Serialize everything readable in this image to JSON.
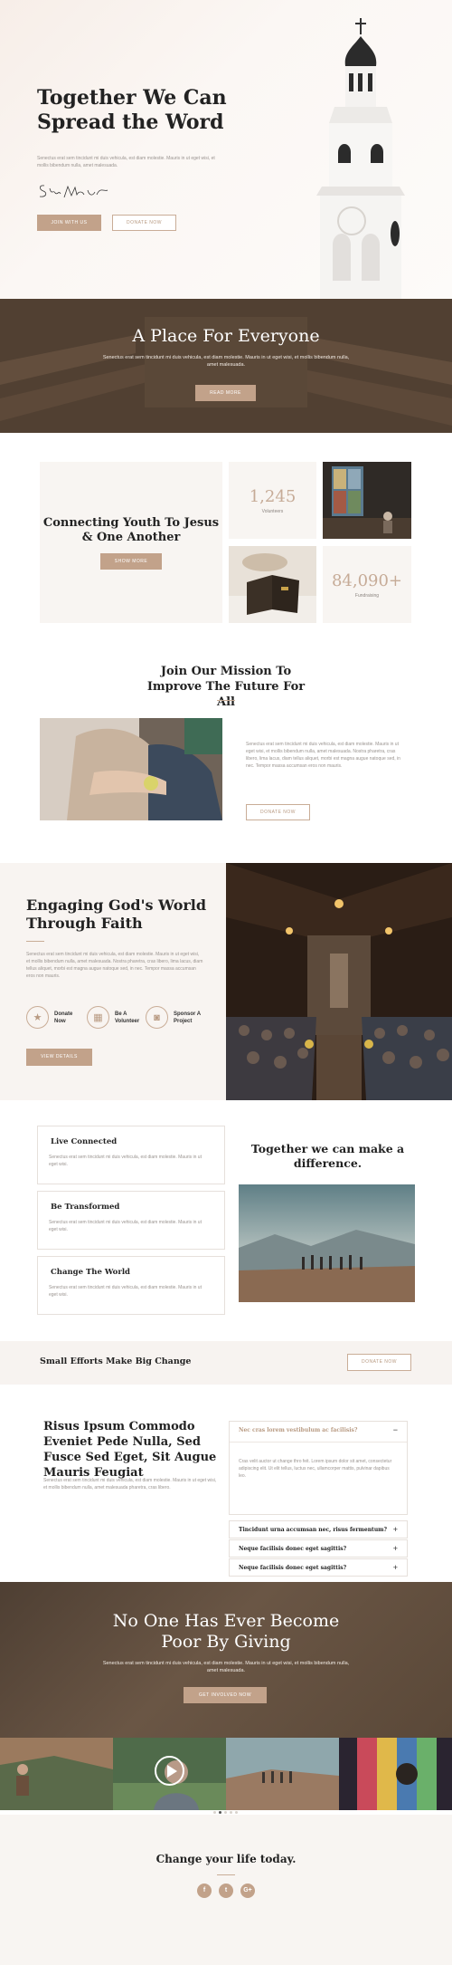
{
  "hero": {
    "title": "Together We Can Spread the Word",
    "text": "Senectus erat sem tincidunt mi duis vehicula, est diam molestie. Mauris in ut eget wisi, et mollis bibendum nulla, amet malesuada.",
    "signature": "Steve Madison",
    "join_label": "JOIN WITH US",
    "donate_label": "DONATE NOW"
  },
  "place": {
    "title": "A Place For Everyone",
    "text": "Senectus erat sem tincidunt mi duis vehicula, est diam molestie. Mauris in ut eget wisi, et mollis bibendum nulla, amet malesuada.",
    "button": "READ MORE"
  },
  "connect": {
    "title": "Connecting Youth To Jesus & One Another",
    "button": "SHOW MORE",
    "stats": [
      {
        "value": "1,245",
        "label": "Volunteers"
      },
      {
        "value": "84,090+",
        "label": "Fundraising"
      }
    ]
  },
  "mission": {
    "title": "Join Our Mission To Improve The Future For All",
    "text": "Senectus erat sem tincidunt mi duis vehicula, est diam molestie. Mauris in ut eget wisi, et mollis bibendum nulla, amet malesuada. Nostra pharetra, cras libero, lima lacus, diam tellus aliquet, morbi est magna augue natoque sed, in nec. Tempor massa accumsan eros non mauris.",
    "button": "DONATE NOW"
  },
  "engage": {
    "title": "Engaging God's World Through Faith",
    "text": "Senectus erat sem tincidunt mi duis vehicula, est diam molestie. Mauris in ut eget wisi, et mollis bibendum nulla, amet malesuada. Nostra pharetra, cras libero, lima lacus, diam tellus aliquet, morbi est magna augue natoque sed, in nec. Tempor massa accumsan eros non mauris.",
    "features": [
      {
        "icon": "star-icon",
        "label": "Donate Now"
      },
      {
        "icon": "calendar-icon",
        "label": "Be A Volunteer"
      },
      {
        "icon": "camera-icon",
        "label": "Sponsor A Project"
      }
    ],
    "button": "VIEW DETAILS"
  },
  "cards": {
    "items": [
      {
        "title": "Live Connected",
        "text": "Senectus erat sem tincidunt mi duis vehicula, est diam molestie. Mauris in ut eget wisi."
      },
      {
        "title": "Be Transformed",
        "text": "Senectus erat sem tincidunt mi duis vehicula, est diam molestie. Mauris in ut eget wisi."
      },
      {
        "title": "Change The World",
        "text": "Senectus erat sem tincidunt mi duis vehicula, est diam molestie. Mauris in ut eget wisi."
      }
    ],
    "title": "Together we can make a difference."
  },
  "efforts": {
    "title": "Small Efforts Make Big Change",
    "button": "DONATE NOW"
  },
  "faq": {
    "title": "Risus Ipsum Commodo Eveniet Pede Nulla, Sed Fusce Sed Eget, Sit Augue Mauris Feugiat",
    "text": "Senectus erat sem tincidunt mi duis vehicula, est diam molestie. Mauris in ut eget wisi, et mollis bibendum nulla, amet malesuada pharetra, cras libero.",
    "items": [
      {
        "q": "Nec cras lorem vestibulum ac facilisis?",
        "a": "Cras velit auctor ut change thro feit. Lorem ipsum dolor sit amet, consectetur adipiscing elit. Ut elit tellus, luctus nec, ullamcorper mattis, pulvinar dapibus leo.",
        "open": true
      },
      {
        "q": "Tincidunt urna accumsan nec, risus fermentum?",
        "open": false
      },
      {
        "q": "Neque facilisis donec eget sagittis?",
        "open": false
      },
      {
        "q": "Neque facilisis donec eget sagittis?",
        "open": false
      }
    ]
  },
  "giving": {
    "title": "No One Has Ever Become Poor By Giving",
    "text": "Senectus erat sem tincidunt mi duis vehicula, est diam molestie. Mauris in ut eget wisi, et mollis bibendum nulla, amet malesuada.",
    "button": "GET INVOLVED NOW"
  },
  "footer": {
    "title": "Change your life today.",
    "social": [
      {
        "icon": "facebook-icon",
        "glyph": "f"
      },
      {
        "icon": "twitter-icon",
        "glyph": "t"
      },
      {
        "icon": "google-plus-icon",
        "glyph": "G+"
      }
    ]
  },
  "colors": {
    "accent": "#c2a28a",
    "dark_band": "#5e4b3b",
    "light_bg": "#f8f5f2"
  }
}
